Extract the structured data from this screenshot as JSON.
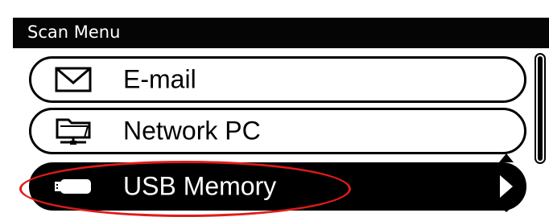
{
  "window": {
    "title": "Scan Menu"
  },
  "menu": {
    "items": [
      {
        "label": "E-mail",
        "icon": "envelope-icon"
      },
      {
        "label": "Network PC",
        "icon": "network-folder-icon"
      },
      {
        "label": "USB Memory",
        "icon": "usb-drive-icon",
        "selected": true
      }
    ]
  },
  "colors": {
    "selected_bg": "#000000",
    "highlight_annotation": "#e01a1a"
  }
}
